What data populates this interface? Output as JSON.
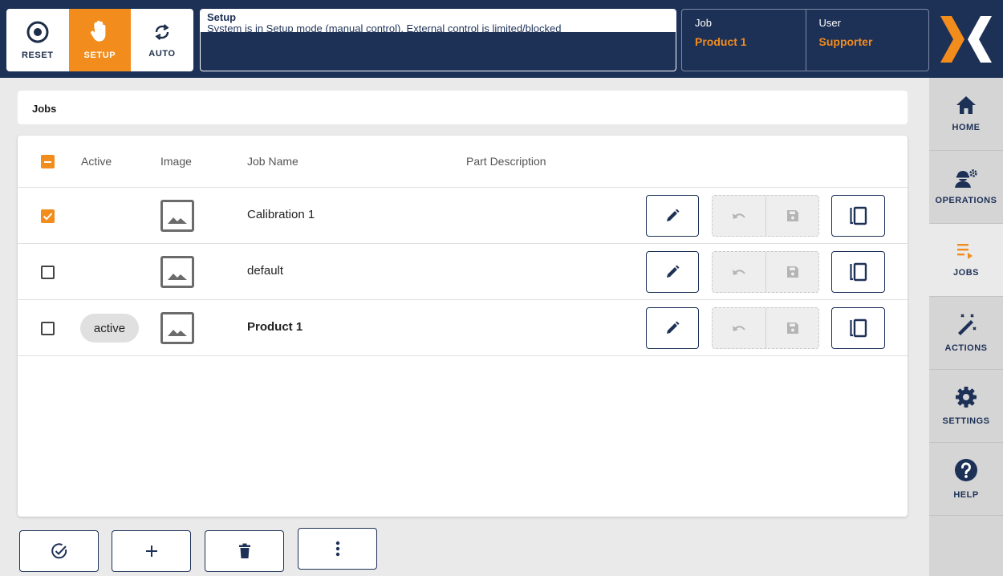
{
  "modes": {
    "reset_label": "RESET",
    "setup_label": "SETUP",
    "auto_label": "AUTO",
    "active": "SETUP"
  },
  "status": {
    "title": "Setup",
    "message": "System is in Setup mode (manual control). External control is limited/blocked"
  },
  "job_info": {
    "job_label": "Job",
    "job_value": "Product 1",
    "user_label": "User",
    "user_value": "Supporter"
  },
  "nav": [
    {
      "label": "HOME",
      "icon": "home-icon"
    },
    {
      "label": "OPERATIONS",
      "icon": "operations-icon"
    },
    {
      "label": "JOBS",
      "icon": "jobs-icon",
      "active": true
    },
    {
      "label": "ACTIONS",
      "icon": "actions-icon"
    },
    {
      "label": "SETTINGS",
      "icon": "settings-icon"
    },
    {
      "label": "HELP",
      "icon": "help-icon"
    }
  ],
  "breadcrumb": "Jobs",
  "table": {
    "headers": {
      "active": "Active",
      "image": "Image",
      "job_name": "Job Name",
      "part_description": "Part Description"
    },
    "rows": [
      {
        "checked": true,
        "active_badge": "",
        "job_name": "Calibration 1",
        "part_description": "",
        "bold": false
      },
      {
        "checked": false,
        "active_badge": "",
        "job_name": "default",
        "part_description": "",
        "bold": false
      },
      {
        "checked": false,
        "active_badge": "active",
        "job_name": "Product 1",
        "part_description": "",
        "bold": true
      }
    ]
  },
  "colors": {
    "navy": "#1d3157",
    "orange": "#f28c1c",
    "nav_bg": "#d5d5d5",
    "page_bg": "#eaeaea"
  },
  "bottom_actions": [
    "check-circle-icon",
    "plus-icon",
    "trash-icon",
    "more-vertical-icon"
  ]
}
